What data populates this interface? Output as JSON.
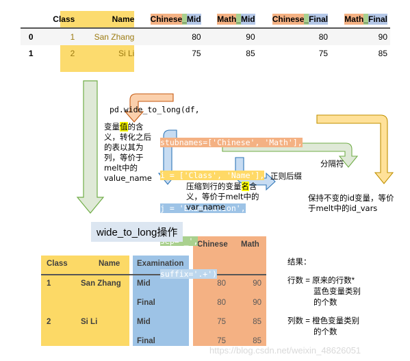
{
  "source_table": {
    "index_header": "",
    "columns": [
      {
        "label": "Class",
        "style": "plain"
      },
      {
        "label": "Name",
        "style": "plain"
      },
      {
        "label": "Chinese_Mid",
        "stub": "Chinese",
        "sep": "_",
        "suffix": "Mid"
      },
      {
        "label": "Math_Mid",
        "stub": "Math",
        "sep": "_",
        "suffix": "Mid"
      },
      {
        "label": "Chinese_Final",
        "stub": "Chinese",
        "sep": "_",
        "suffix": "Final"
      },
      {
        "label": "Math_Final",
        "stub": "Math",
        "sep": "_",
        "suffix": "Final"
      }
    ],
    "rows": [
      {
        "index": "0",
        "Class": "1",
        "Name": "San Zhang",
        "Chinese_Mid": "80",
        "Math_Mid": "90",
        "Chinese_Final": "80",
        "Math_Final": "90"
      },
      {
        "index": "1",
        "Class": "2",
        "Name": "Si Li",
        "Chinese_Mid": "75",
        "Math_Mid": "85",
        "Chinese_Final": "75",
        "Math_Final": "85"
      }
    ]
  },
  "code": {
    "line1": "pd.wide_to_long(df,",
    "line2": "stubnames=['Chinese', 'Math'],",
    "line3": "i = ['Class', 'Name'],",
    "line4": "j = 'Examination',",
    "line5": "sep='_',",
    "line6": "suffix='.+')"
  },
  "annotations": {
    "value_meaning": {
      "before": "变量",
      "highlight": "值",
      "after": "的含义，转化之后的表以其为列，等价于melt中的value_name"
    },
    "var_name_meaning": {
      "before": "压缩到行的变量",
      "highlight": "名",
      "after": "含义，等价于melt中的var_name"
    },
    "suffix_label": "正则后缀",
    "sep_label": "分隔符",
    "id_vars_label": "保持不变的id变量，等价于melt中的id_vars"
  },
  "operation_label": "wide_to_long操作",
  "result_table": {
    "columns": [
      "Class",
      "Name",
      "Examination",
      "Chinese",
      "Math"
    ],
    "rows": [
      {
        "Class": "1",
        "Name": "San Zhang",
        "Examination": "Mid",
        "Chinese": "80",
        "Math": "90"
      },
      {
        "Class": "",
        "Name": "",
        "Examination": "Final",
        "Chinese": "80",
        "Math": "90"
      },
      {
        "Class": "2",
        "Name": "Si Li",
        "Examination": "Mid",
        "Chinese": "75",
        "Math": "85"
      },
      {
        "Class": "",
        "Name": "",
        "Examination": "Final",
        "Chinese": "75",
        "Math": "85"
      }
    ]
  },
  "result_notes": {
    "title": "结果：",
    "rows_line1": "行数 = 原来的行数*",
    "rows_line2": "蓝色变量类别",
    "rows_line3": "的个数",
    "cols_line1": "列数 = 橙色变量类别",
    "cols_line2": "的个数"
  },
  "watermark": "https://blog.csdn.net/weixin_48626051",
  "colors": {
    "orange": "#f4b183",
    "yellow": "#ffd966",
    "blue": "#9dc3e6",
    "green": "#a9d08e",
    "light_blue": "#bdd7ee",
    "highlight_yellow": "#ffff00"
  }
}
